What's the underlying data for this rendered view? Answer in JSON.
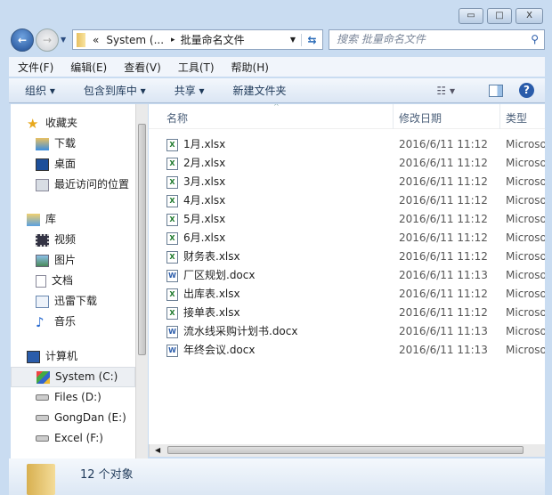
{
  "window": {
    "minimize": "▭",
    "maximize": "□",
    "close": "X"
  },
  "address": {
    "prefix": "«",
    "path1": "System (...",
    "sep": "▸",
    "path2": "批量命名文件"
  },
  "search": {
    "placeholder": "搜索 批量命名文件"
  },
  "menu": [
    "文件(F)",
    "编辑(E)",
    "查看(V)",
    "工具(T)",
    "帮助(H)"
  ],
  "toolbar": {
    "organize": "组织 ▾",
    "include": "包含到库中 ▾",
    "share": "共享 ▾",
    "new_folder": "新建文件夹"
  },
  "nav": {
    "favorites": {
      "label": "收藏夹",
      "items": [
        "下载",
        "桌面",
        "最近访问的位置"
      ]
    },
    "libraries": {
      "label": "库",
      "items": [
        "视频",
        "图片",
        "文档",
        "迅雷下载",
        "音乐"
      ]
    },
    "computer": {
      "label": "计算机",
      "items": [
        "System (C:)",
        "Files (D:)",
        "GongDan (E:)",
        "Excel (F:)"
      ]
    }
  },
  "columns": {
    "name": "名称",
    "date": "修改日期",
    "type": "类型"
  },
  "files": [
    {
      "name": "1月.xlsx",
      "date": "2016/6/11 11:12",
      "type": "Microso",
      "kind": "x"
    },
    {
      "name": "2月.xlsx",
      "date": "2016/6/11 11:12",
      "type": "Microso",
      "kind": "x"
    },
    {
      "name": "3月.xlsx",
      "date": "2016/6/11 11:12",
      "type": "Microso",
      "kind": "x"
    },
    {
      "name": "4月.xlsx",
      "date": "2016/6/11 11:12",
      "type": "Microso",
      "kind": "x"
    },
    {
      "name": "5月.xlsx",
      "date": "2016/6/11 11:12",
      "type": "Microso",
      "kind": "x"
    },
    {
      "name": "6月.xlsx",
      "date": "2016/6/11 11:12",
      "type": "Microso",
      "kind": "x"
    },
    {
      "name": "财务表.xlsx",
      "date": "2016/6/11 11:12",
      "type": "Microso",
      "kind": "x"
    },
    {
      "name": "厂区规划.docx",
      "date": "2016/6/11 11:13",
      "type": "Microso",
      "kind": "w"
    },
    {
      "name": "出库表.xlsx",
      "date": "2016/6/11 11:12",
      "type": "Microso",
      "kind": "x"
    },
    {
      "name": "接单表.xlsx",
      "date": "2016/6/11 11:12",
      "type": "Microso",
      "kind": "x"
    },
    {
      "name": "流水线采购计划书.docx",
      "date": "2016/6/11 11:13",
      "type": "Microso",
      "kind": "w"
    },
    {
      "name": "年终会议.docx",
      "date": "2016/6/11 11:13",
      "type": "Microso",
      "kind": "w"
    }
  ],
  "status": {
    "count": "12 个对象"
  },
  "colors": {
    "excel": "#1f7a2e",
    "word": "#2a5caa",
    "accent": "#1e3959"
  }
}
